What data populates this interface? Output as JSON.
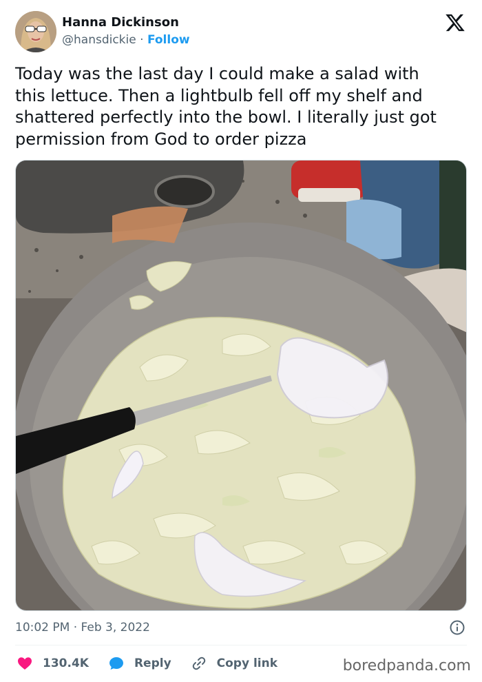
{
  "author": {
    "display_name": "Hanna Dickinson",
    "handle": "@hansdickie",
    "separator": "·",
    "follow_label": "Follow"
  },
  "platform_icon": "x-logo-icon",
  "tweet": {
    "lines": [
      "Today was the last day I could make a salad with",
      "this lettuce. Then a lightbulb fell off my shelf and",
      "shattered perfectly into the bowl. I literally just got",
      "permission from God to order pizza"
    ]
  },
  "timestamp": {
    "time": "10:02 PM",
    "separator": "·",
    "date": "Feb 3, 2022"
  },
  "actions": {
    "like_count": "130.4K",
    "reply_label": "Reply",
    "copy_label": "Copy link"
  },
  "watermark": "boredpanda.com",
  "colors": {
    "accent": "#1d9bf0",
    "like": "#f91880",
    "text": "#0f1419",
    "muted": "#536471"
  }
}
